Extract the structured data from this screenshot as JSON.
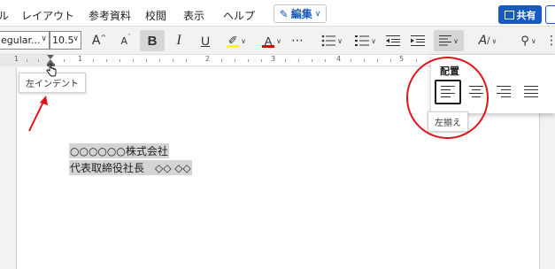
{
  "menu": {
    "tabs": [
      "レイアウト",
      "参考資料",
      "校閲",
      "表示",
      "ヘルプ"
    ],
    "partial_left": "ル",
    "edit_label": "編集",
    "share_label": "共有"
  },
  "ribbon": {
    "font_name": "egular...",
    "font_size": "10.5",
    "grow_font": "A",
    "shrink_font": "A",
    "bold": "B",
    "italic": "I",
    "underline": "U",
    "font_color_glyph": "A",
    "more": "⋯"
  },
  "ruler": {
    "numbers": [
      "1",
      "1",
      "2",
      "3",
      "4",
      "5"
    ]
  },
  "indent_tooltip": "左インデント",
  "document": {
    "lines": [
      "○○○○○○株式会社",
      "代表取締役社長　◇◇ ◇◇"
    ]
  },
  "align_panel": {
    "title": "配置",
    "options": [
      "左揃え",
      "中央揃え",
      "右揃え",
      "両端揃え"
    ],
    "selected": "左揃え",
    "tooltip": "左揃え"
  },
  "colors": {
    "accent": "#185abd",
    "annotation": "#e0141c",
    "highlight": "#ffff00",
    "font_color": "#e00000"
  }
}
